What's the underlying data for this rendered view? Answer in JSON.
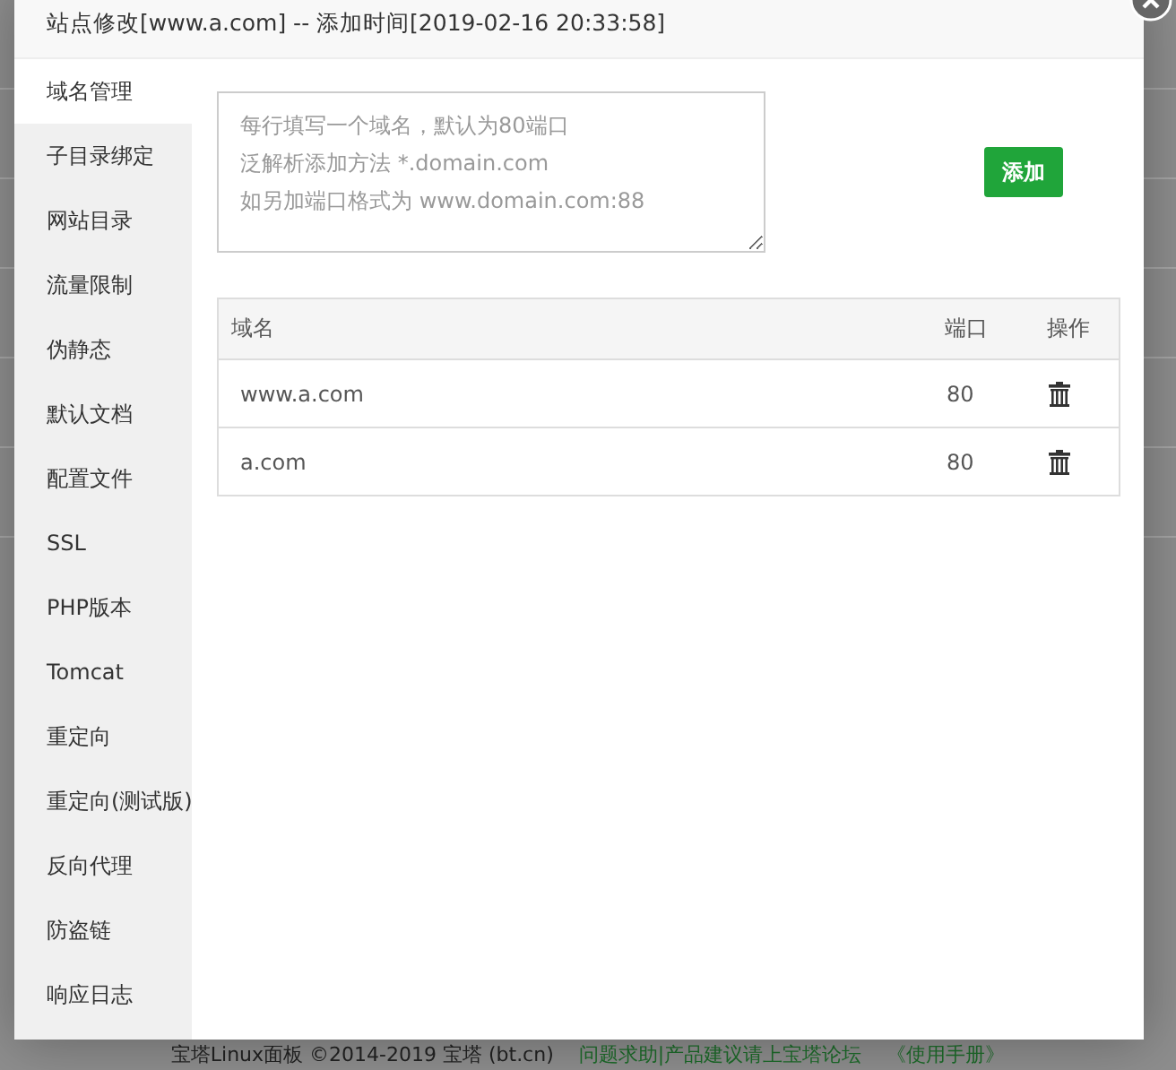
{
  "dialog": {
    "title": "站点修改[www.a.com] -- 添加时间[2019-02-16 20:33:58]"
  },
  "sidebar": {
    "items": [
      {
        "label": "域名管理",
        "selected": true
      },
      {
        "label": "子目录绑定",
        "selected": false
      },
      {
        "label": "网站目录",
        "selected": false
      },
      {
        "label": "流量限制",
        "selected": false
      },
      {
        "label": "伪静态",
        "selected": false
      },
      {
        "label": "默认文档",
        "selected": false
      },
      {
        "label": "配置文件",
        "selected": false
      },
      {
        "label": "SSL",
        "selected": false
      },
      {
        "label": "PHP版本",
        "selected": false
      },
      {
        "label": "Tomcat",
        "selected": false
      },
      {
        "label": "重定向",
        "selected": false
      },
      {
        "label": "重定向(测试版)",
        "selected": false
      },
      {
        "label": "反向代理",
        "selected": false
      },
      {
        "label": "防盗链",
        "selected": false
      },
      {
        "label": "响应日志",
        "selected": false
      }
    ]
  },
  "domain_input": {
    "placeholder_lines": [
      "每行填写一个域名，默认为80端口",
      "泛解析添加方法 *.domain.com",
      "如另加端口格式为 www.domain.com:88"
    ]
  },
  "add_button": "添加",
  "table": {
    "columns": [
      "域名",
      "端口",
      "操作"
    ],
    "rows": [
      {
        "domain": "www.a.com",
        "port": "80"
      },
      {
        "domain": "a.com",
        "port": "80"
      }
    ]
  },
  "footer": {
    "copyright": "宝塔Linux面板 ©2014-2019 宝塔 (bt.cn)",
    "forum_link": "问题求助|产品建议请上宝塔论坛",
    "manual_link": "《使用手册》"
  }
}
